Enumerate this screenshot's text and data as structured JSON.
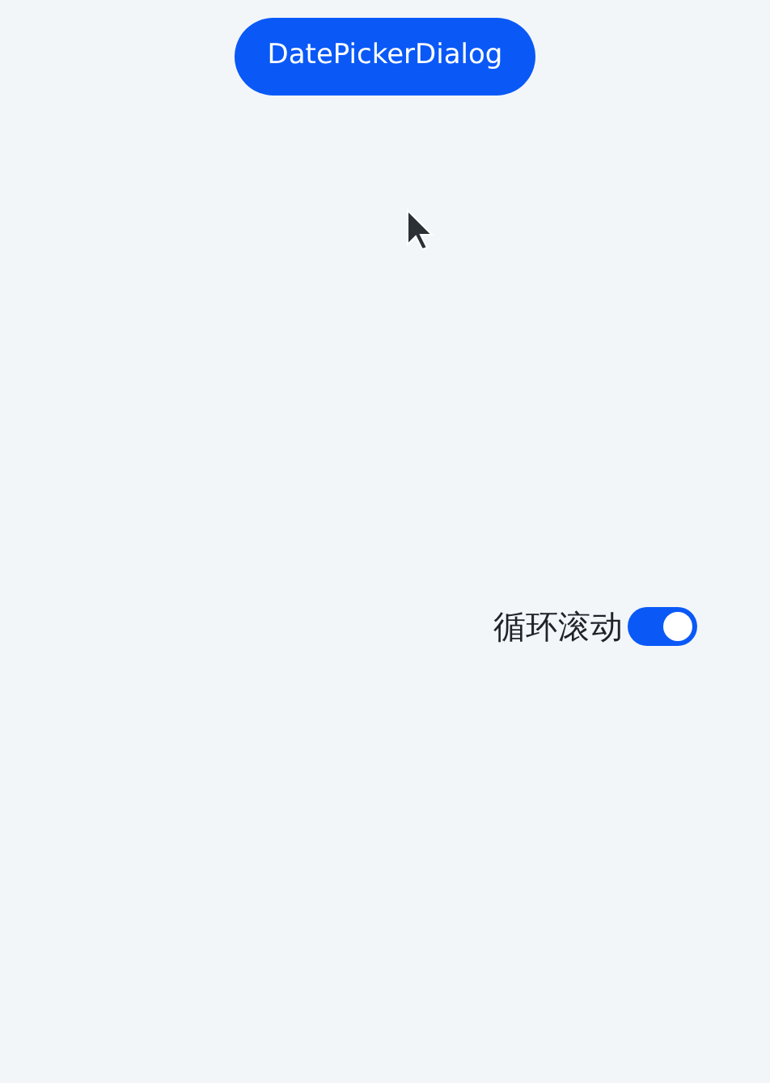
{
  "button": {
    "label": "DatePickerDialog"
  },
  "loop_toggle": {
    "label": "循环滚动",
    "on": true
  }
}
